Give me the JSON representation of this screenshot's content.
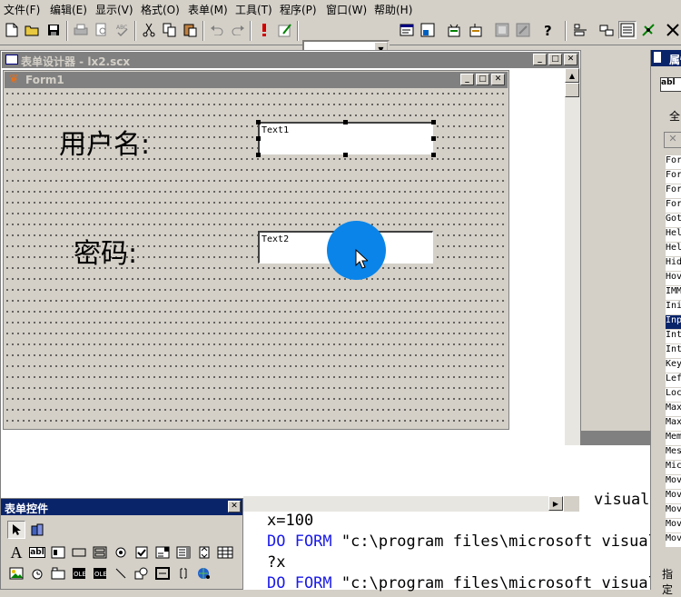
{
  "menubar": {
    "items": [
      "文件(F)",
      "编辑(E)",
      "显示(V)",
      "格式(O)",
      "表单(M)",
      "工具(T)",
      "程序(P)",
      "窗口(W)",
      "帮助(H)"
    ]
  },
  "designer": {
    "title": "表单设计器 - lx2.scx"
  },
  "form1": {
    "title": "Form1",
    "username_label": "用户名:",
    "password_label": "密码:",
    "text1": "Text1",
    "text2": "Text2"
  },
  "command_window": {
    "lines": [
      {
        "kw": "",
        "text": "visual"
      },
      {
        "kw": "",
        "text": "x=100"
      },
      {
        "kw": "DO FORM",
        "text": " \"c:\\program files\\microsoft visual"
      },
      {
        "kw": "",
        "text": "?x"
      },
      {
        "kw": "DO FORM",
        "text": " \"c:\\program files\\microsoft visual"
      }
    ]
  },
  "controls_toolbar": {
    "title": "表单控件",
    "label_tool": "A",
    "textbox_tool": "abl"
  },
  "properties": {
    "title": "属性",
    "object_combo": "abl",
    "tab_all": "全",
    "rows": [
      "For",
      "For",
      "For",
      "For",
      "Got",
      "Hel",
      "Hel",
      "Hid",
      "Hov",
      "IMM",
      "Ini",
      "Inp",
      "Int",
      "Int",
      "Key",
      "Lef",
      "Loc",
      "Max",
      "Max",
      "Mem",
      "Mes",
      "Mic",
      "Mov",
      "Mov",
      "Mov",
      "Mov",
      "Mov"
    ],
    "selected_index": 11,
    "footer": "指定"
  },
  "colors": {
    "inactive_title": "#808080",
    "active_title": "#0a246a",
    "cursor_highlight": "#0a84e8",
    "keyword": "#1a1ae8"
  }
}
